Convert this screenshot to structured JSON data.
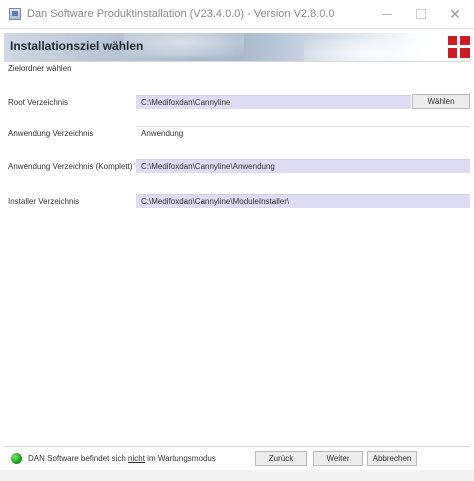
{
  "window": {
    "title": "Dan Software Produktinstallation (V23.4.0.0) - Version V2.8.0.0",
    "minimize_glyph": "",
    "maximize_glyph": "",
    "close_glyph": "✕"
  },
  "header": {
    "title": "Installationsziel wählen",
    "logo_color": "#d01b22"
  },
  "section": {
    "heading": "Zielordner wählen"
  },
  "fields": [
    {
      "label": "Root Verzeichnis",
      "value": "C:\\Medifoxdan\\Cannyline",
      "editable": false
    },
    {
      "label": "Anwendung Verzeichnis",
      "value": "Anwendung",
      "editable": true
    },
    {
      "label": "Anwendung Verzeichnis (Komplett)",
      "value": "C:\\Medifoxdan\\Cannyline\\Anwendung",
      "editable": false
    },
    {
      "label": "Installer Verzeichnis",
      "value": "C:\\Medifoxdan\\Cannyline\\ModuleInstaller\\",
      "editable": false
    }
  ],
  "buttons": {
    "choose": "Wählen",
    "back": "Zurück",
    "next": "Weiter",
    "cancel": "Abbrechen"
  },
  "status": {
    "prefix": "DAN Software befindet sich ",
    "emphasis": "nicht",
    "suffix": " im Wartungsmodus",
    "indicator_color": "#18a11b"
  }
}
